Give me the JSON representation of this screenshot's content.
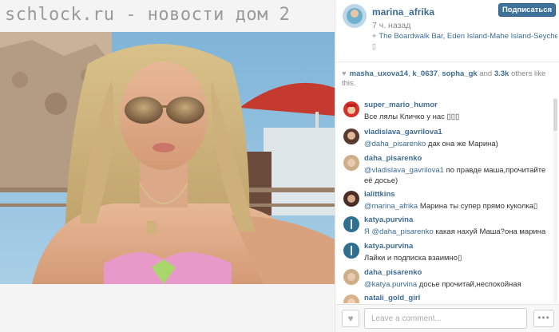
{
  "watermark": "schlock.ru - новости дом 2",
  "post": {
    "username": "marina_afrika",
    "follow_label": "Подписаться",
    "time": "7 ч. назад",
    "location": "The Boardwalk Bar, Eden Island-Mahe Island-Seychelles",
    "location_tofu": "▯",
    "likes": {
      "users": [
        "masha_uxova14",
        "k_0637",
        "sopha_gk"
      ],
      "and": "and",
      "count": "3.3k",
      "suffix": "others like this."
    }
  },
  "comments": [
    {
      "user": "super_mario_humor",
      "mention": "",
      "text": "Все лялы Кличко у нас ▯▯▯"
    },
    {
      "user": "vladislava_gavrilova1",
      "mention": "@daha_pisarenko",
      "text": " дак она же Марина)"
    },
    {
      "user": "daha_pisarenko",
      "mention": "@vladislava_gavrilova1",
      "text": " по правде маша,прочитайте её досье)"
    },
    {
      "user": "lalittkins",
      "mention": "@marina_afrika",
      "text": " Марина ты супер прямо куколка▯"
    },
    {
      "user": "katya.purvina",
      "mention": "Я @daha_pisarenko",
      "text": " какая нахуй Маша?она марина"
    },
    {
      "user": "katya.purvina",
      "mention": "",
      "text": "Лайки и подписка взаимно▯"
    },
    {
      "user": "daha_pisarenko",
      "mention": "@katya.purvina",
      "text": " досье прочитай,неспокойная"
    },
    {
      "user": "natali_gold_girl",
      "mention": "",
      "text": ""
    }
  ],
  "footer": {
    "comment_placeholder": "Leave a comment...",
    "more_label": "•••"
  },
  "icons": {
    "location": "map-pin-icon",
    "like": "heart-icon",
    "more": "more-dots-icon"
  },
  "colors": {
    "accent": "#3f729b",
    "link": "#3f6c94"
  }
}
